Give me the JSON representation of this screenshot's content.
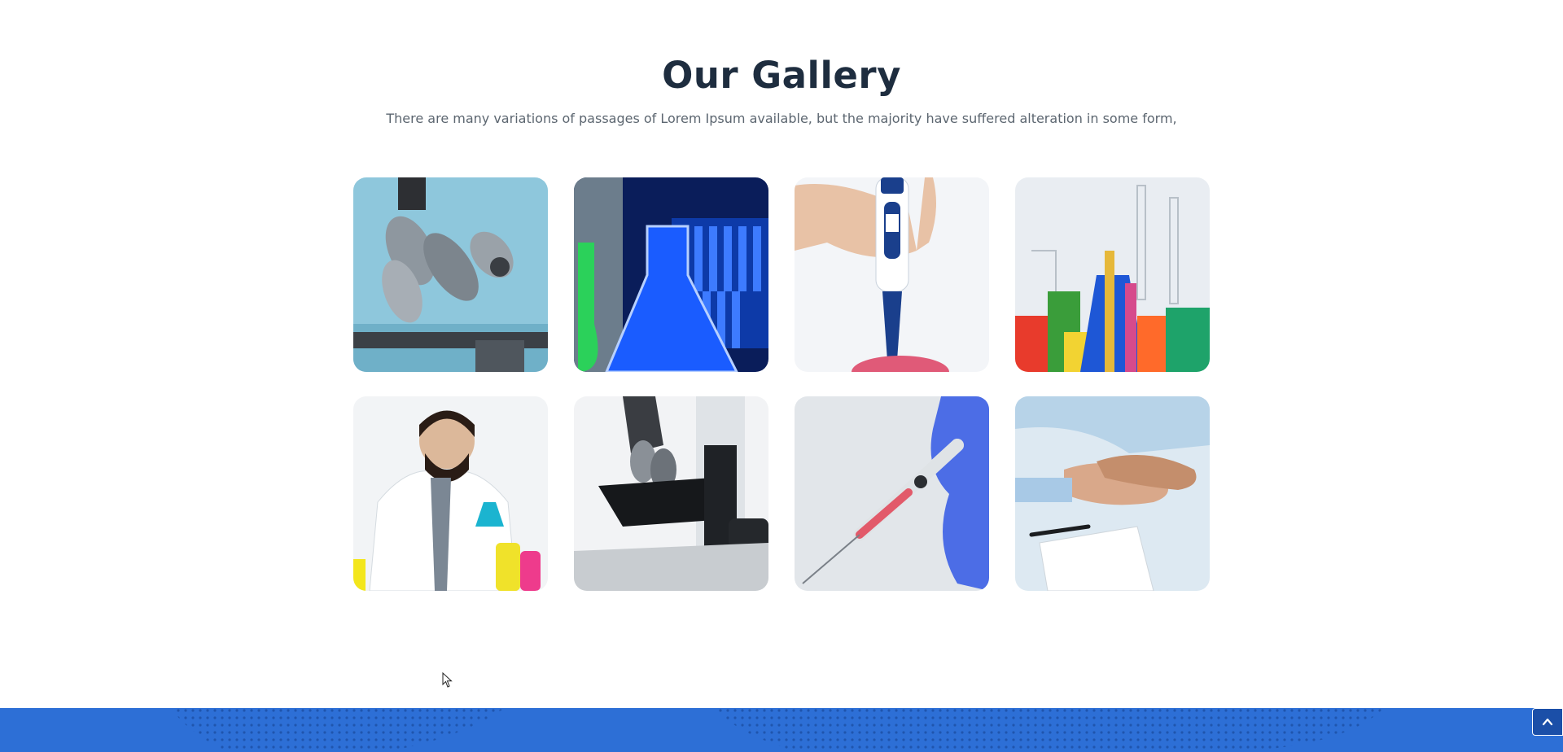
{
  "gallery": {
    "title": "Our Gallery",
    "subtitle": "There are many variations of passages of Lorem Ipsum available, but the majority have suffered alteration in some form,",
    "images": [
      {
        "name": "gallery-image-microscope-closeup"
      },
      {
        "name": "gallery-image-blue-flasks"
      },
      {
        "name": "gallery-image-pipette-hand"
      },
      {
        "name": "gallery-image-colored-glassware"
      },
      {
        "name": "gallery-image-scientist-with-flask"
      },
      {
        "name": "gallery-image-lab-microscope"
      },
      {
        "name": "gallery-image-syringe-gloved-hand"
      },
      {
        "name": "gallery-image-holding-hands"
      }
    ]
  },
  "colors": {
    "title": "#1e2d3f",
    "subtitle": "#5c6670",
    "footer": "#2d6fd6",
    "back_to_top": "#1b4fa8"
  },
  "back_to_top": {
    "icon": "chevron-up-icon"
  }
}
